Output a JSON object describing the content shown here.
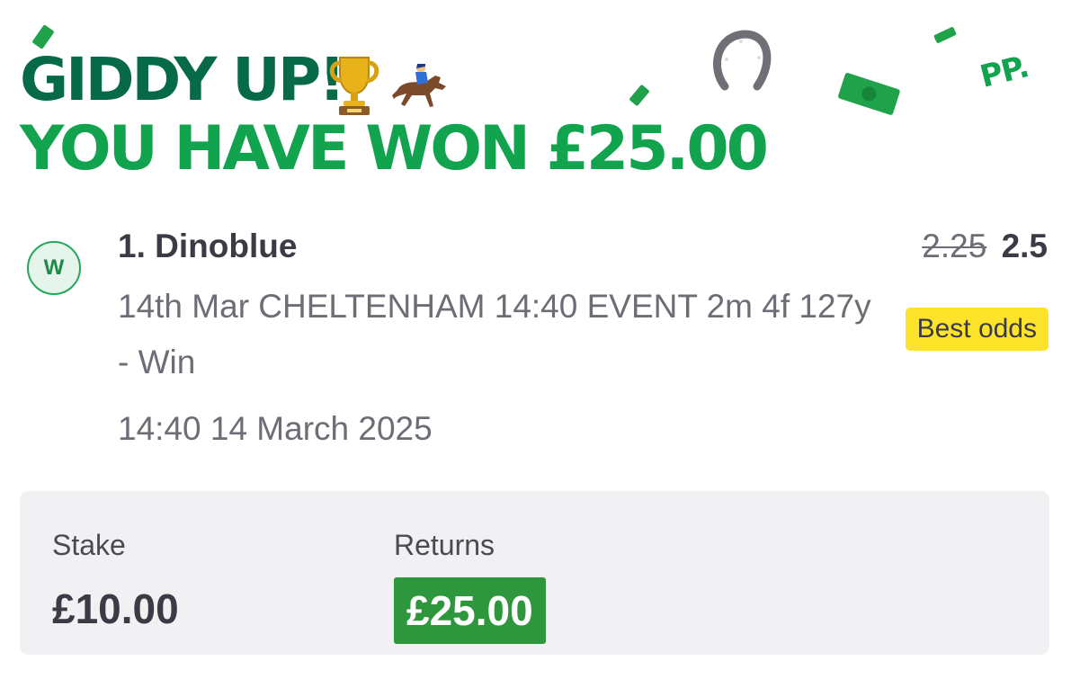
{
  "banner": {
    "headline": "GIDDY UP!",
    "win_message": "YOU HAVE WON £25.00",
    "brand_mark": "PP."
  },
  "icons": {
    "trophy": "trophy-icon",
    "jockey": "horse-racing-icon",
    "horseshoe": "horseshoe-icon",
    "cash": "banknote-icon"
  },
  "selection": {
    "result_badge": "W",
    "name": "1. Dinoblue",
    "description": "14th Mar CHELTENHAM 14:40 EVENT 2m 4f 127y - Win",
    "event_time": "14:40 14 March 2025",
    "odds_old": "2.25",
    "odds_new": "2.5",
    "odds_tag": "Best odds"
  },
  "summary": {
    "stake_label": "Stake",
    "stake_value": "£10.00",
    "returns_label": "Returns",
    "returns_value": "£25.00"
  },
  "colors": {
    "headline_dark_green": "#066a48",
    "headline_green": "#12a34f",
    "best_odds_yellow": "#fde42a",
    "returns_green": "#2e963d",
    "panel_grey": "#f1f1f4"
  }
}
